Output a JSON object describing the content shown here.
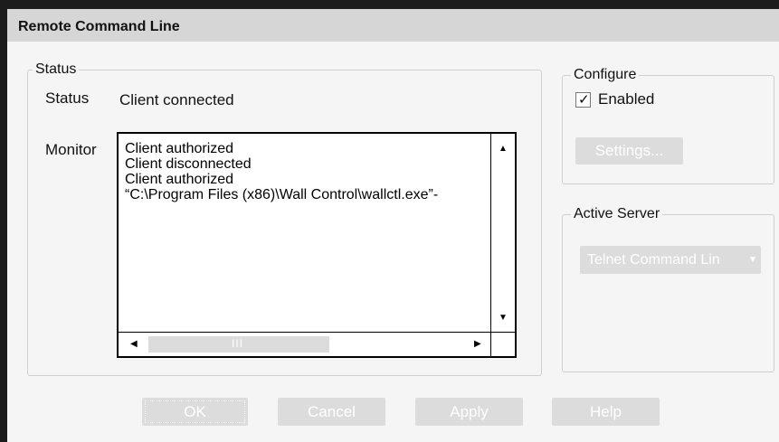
{
  "window": {
    "title": "Remote Command Line"
  },
  "status_group": {
    "legend": "Status",
    "status_label": "Status",
    "status_value": "Client connected",
    "monitor_label": "Monitor",
    "monitor_lines": [
      "Client authorized",
      "Client disconnected",
      "Client authorized",
      "“C:\\Program Files (x86)\\Wall Control\\wallctl.exe”-"
    ],
    "scroll_up_icon": "▲",
    "scroll_down_icon": "▼",
    "scroll_left_icon": "◀",
    "scroll_right_icon": "▶",
    "thumb_grip": "III"
  },
  "configure_group": {
    "legend": "Configure",
    "enabled_label": "Enabled",
    "enabled_checked": true,
    "check_mark": "✓",
    "settings_button": "Settings..."
  },
  "active_server_group": {
    "legend": "Active Server",
    "selected_value": "Telnet Command Lin",
    "caret": "▼"
  },
  "buttons": {
    "ok": "OK",
    "cancel": "Cancel",
    "apply": "Apply",
    "help": "Help"
  },
  "colors": {
    "window_bg": "#f5f5f5",
    "titlebar_bg": "#d6d6d6",
    "disabled_button_bg": "#dcdcdc",
    "outer_bg": "#1c1c1c"
  }
}
